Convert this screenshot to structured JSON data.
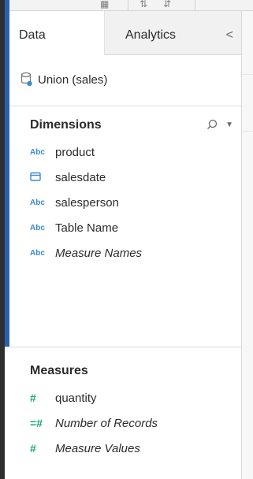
{
  "tabs": {
    "data_label": "Data",
    "analytics_label": "Analytics",
    "collapse_glyph": "<"
  },
  "datasource": {
    "name": "Union (sales)",
    "icon": "datasource-icon"
  },
  "dimensions": {
    "title": "Dimensions",
    "items": [
      {
        "type": "Abc",
        "label": "product",
        "italic": false
      },
      {
        "type": "date",
        "label": "salesdate",
        "italic": false
      },
      {
        "type": "Abc",
        "label": "salesperson",
        "italic": false
      },
      {
        "type": "Abc",
        "label": "Table Name",
        "italic": false
      },
      {
        "type": "Abc",
        "label": "Measure Names",
        "italic": true
      }
    ]
  },
  "measures": {
    "title": "Measures",
    "items": [
      {
        "type": "#",
        "label": "quantity",
        "italic": false
      },
      {
        "type": "=#",
        "label": "Number of Records",
        "italic": true
      },
      {
        "type": "#",
        "label": "Measure Values",
        "italic": true
      }
    ]
  },
  "colors": {
    "accent_blue": "#2b5fb4",
    "string_type": "#3c8ad1",
    "number_type": "#1aa37a"
  }
}
